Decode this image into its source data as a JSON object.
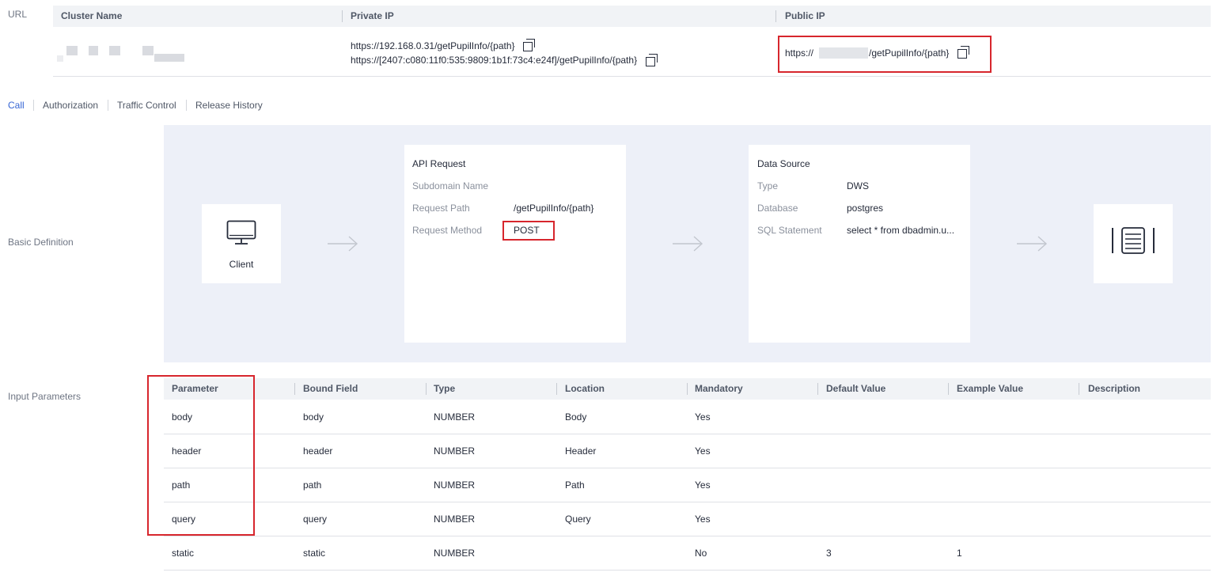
{
  "url_section": {
    "label": "URL",
    "headers": {
      "cluster_name": "Cluster Name",
      "private_ip": "Private IP",
      "public_ip": "Public IP"
    },
    "private_ip_urls": [
      "https://192.168.0.31/getPupilInfo/{path}",
      "https://[2407:c080:11f0:535:9809:1b1f:73c4:e24f]/getPupilInfo/{path}"
    ],
    "public_ip_prefix": "https://",
    "public_ip_suffix": "/getPupilInfo/{path}"
  },
  "tabs": [
    {
      "label": "Call",
      "active": true
    },
    {
      "label": "Authorization",
      "active": false
    },
    {
      "label": "Traffic Control",
      "active": false
    },
    {
      "label": "Release History",
      "active": false
    }
  ],
  "basic_definition": {
    "label": "Basic Definition",
    "client_label": "Client",
    "api_request": {
      "title": "API Request",
      "subdomain_label": "Subdomain Name",
      "subdomain_value": "",
      "path_label": "Request Path",
      "path_value": "/getPupilInfo/{path}",
      "method_label": "Request Method",
      "method_value": "POST"
    },
    "data_source": {
      "title": "Data Source",
      "type_label": "Type",
      "type_value": "DWS",
      "database_label": "Database",
      "database_value": "postgres",
      "sql_label": "SQL Statement",
      "sql_value": "select * from dbadmin.u..."
    }
  },
  "input_parameters": {
    "label": "Input Parameters",
    "columns": [
      "Parameter",
      "Bound Field",
      "Type",
      "Location",
      "Mandatory",
      "Default Value",
      "Example Value",
      "Description"
    ],
    "rows": [
      [
        "body",
        "body",
        "NUMBER",
        "Body",
        "Yes",
        "",
        "",
        ""
      ],
      [
        "header",
        "header",
        "NUMBER",
        "Header",
        "Yes",
        "",
        "",
        ""
      ],
      [
        "path",
        "path",
        "NUMBER",
        "Path",
        "Yes",
        "",
        "",
        ""
      ],
      [
        "query",
        "query",
        "NUMBER",
        "Query",
        "Yes",
        "",
        "",
        ""
      ],
      [
        "static",
        "static",
        "NUMBER",
        "",
        "No",
        "3",
        "1",
        ""
      ]
    ]
  },
  "colors": {
    "accent": "#3666d4",
    "highlight_border": "#d7262d",
    "panel_bg": "#edf0f8"
  },
  "icons": [
    "copy-icon",
    "monitor-icon",
    "arrow-right-icon",
    "server-list-icon"
  ]
}
